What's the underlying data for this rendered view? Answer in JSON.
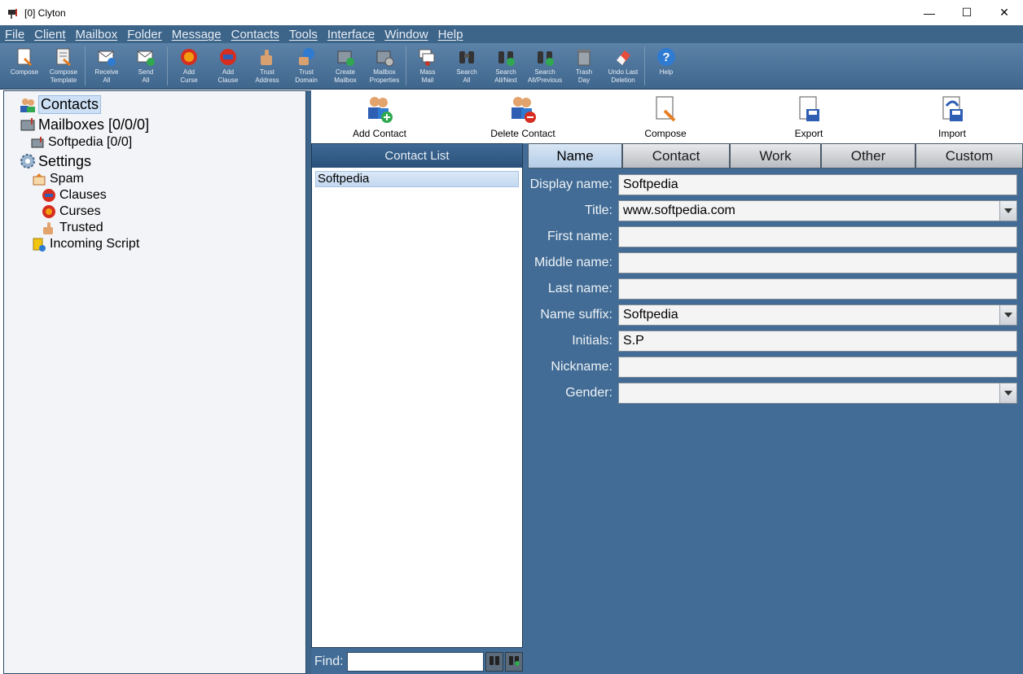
{
  "window": {
    "title": "[0] Clyton"
  },
  "menu": [
    "File",
    "Client",
    "Mailbox",
    "Folder",
    "Message",
    "Contacts",
    "Tools",
    "Interface",
    "Window",
    "Help"
  ],
  "toolbar": [
    {
      "label": "Compose",
      "icon": "compose-icon"
    },
    {
      "label": "Compose\nTemplate",
      "icon": "template-icon"
    },
    {
      "label": "Receive\nAll",
      "icon": "receive-icon"
    },
    {
      "label": "Send\nAll",
      "icon": "send-icon"
    },
    {
      "label": "Add\nCurse",
      "icon": "curse-icon"
    },
    {
      "label": "Add\nClause",
      "icon": "clause-icon"
    },
    {
      "label": "Trust\nAddress",
      "icon": "trust-address-icon"
    },
    {
      "label": "Trust\nDomain",
      "icon": "trust-domain-icon"
    },
    {
      "label": "Create\nMailbox",
      "icon": "create-mailbox-icon"
    },
    {
      "label": "Mailbox\nProperties",
      "icon": "mailbox-properties-icon"
    },
    {
      "label": "Mass\nMail",
      "icon": "mass-mail-icon"
    },
    {
      "label": "Search\nAll",
      "icon": "binoculars-icon"
    },
    {
      "label": "Search\nAll/Next",
      "icon": "search-next-icon"
    },
    {
      "label": "Search\nAll/Previous",
      "icon": "search-previous-icon"
    },
    {
      "label": "Trash\nDay",
      "icon": "trash-icon"
    },
    {
      "label": "Undo Last\nDeletion",
      "icon": "eraser-icon"
    },
    {
      "label": "Help",
      "icon": "help-icon"
    }
  ],
  "tree": {
    "contacts": "Contacts",
    "mailboxes": "Mailboxes [0/0/0]",
    "softpedia": "Softpedia [0/0]",
    "settings": "Settings",
    "spam": "Spam",
    "clauses": "Clauses",
    "curses": "Curses",
    "trusted": "Trusted",
    "incoming_script": "Incoming Script"
  },
  "actions": {
    "add_contact": "Add Contact",
    "delete_contact": "Delete Contact",
    "compose": "Compose",
    "export": "Export",
    "import": "Import"
  },
  "contact_list": {
    "header": "Contact List",
    "items": [
      "Softpedia"
    ],
    "find_label": "Find:",
    "find_value": ""
  },
  "tabs": [
    "Name",
    "Contact",
    "Work",
    "Other",
    "Custom"
  ],
  "active_tab": "Name",
  "form": {
    "display_name": {
      "label": "Display name:",
      "value": "Softpedia"
    },
    "title": {
      "label": "Title:",
      "value": "www.softpedia.com"
    },
    "first_name": {
      "label": "First name:",
      "value": ""
    },
    "middle_name": {
      "label": "Middle name:",
      "value": ""
    },
    "last_name": {
      "label": "Last name:",
      "value": ""
    },
    "name_suffix": {
      "label": "Name suffix:",
      "value": "Softpedia"
    },
    "initials": {
      "label": "Initials:",
      "value": "S.P"
    },
    "nickname": {
      "label": "Nickname:",
      "value": ""
    },
    "gender": {
      "label": "Gender:",
      "value": ""
    }
  },
  "colors": {
    "menubar": "#3d6489",
    "content_bg": "#426c95",
    "accent": "#2a5079"
  }
}
